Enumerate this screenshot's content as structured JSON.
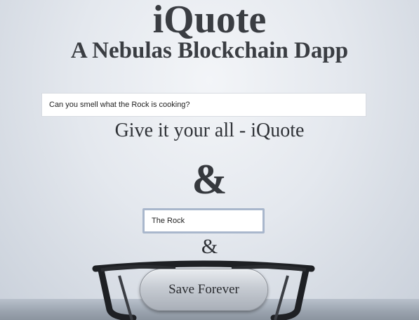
{
  "app": {
    "title": "iQuote",
    "subtitle": "A Nebulas Blockchain Dapp"
  },
  "quote": {
    "input_value": "Can you smell what the Rock is cooking?",
    "display_text": "Give it your all - iQuote"
  },
  "separator": {
    "big": "&",
    "small": "&"
  },
  "author": {
    "input_value": "The Rock"
  },
  "actions": {
    "save_label": "Save Forever"
  },
  "colors": {
    "text": "#3a3d42",
    "input_focus_border": "#a9b7cc",
    "button_top": "#e8ebef",
    "button_bottom": "#a9afb8"
  },
  "icons": {
    "background": "eyeglasses-image"
  }
}
